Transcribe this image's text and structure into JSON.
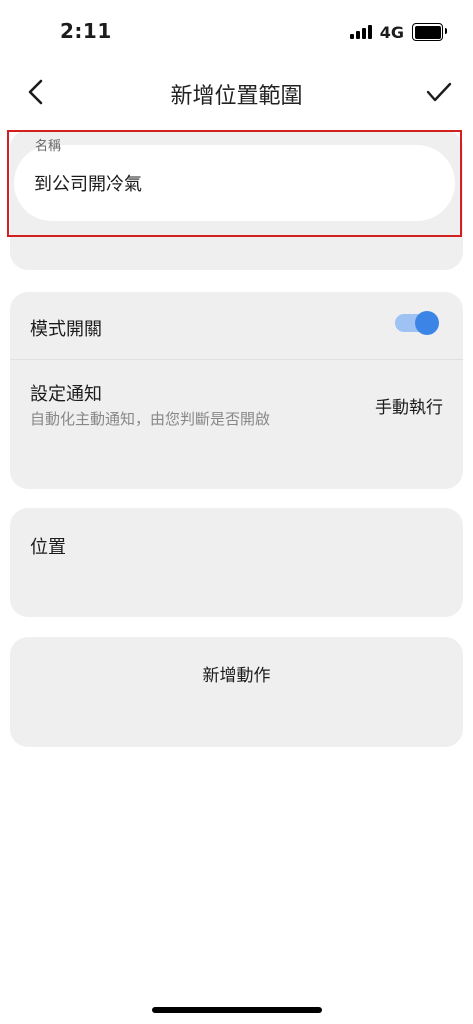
{
  "status_bar": {
    "time": "2:11",
    "network": "4G",
    "icons": {
      "signal": "cellular-signal-icon",
      "battery": "battery-icon"
    }
  },
  "nav": {
    "title": "新增位置範圍",
    "back_icon": "chevron-left-icon",
    "confirm_icon": "checkmark-icon"
  },
  "name_section": {
    "label": "名稱",
    "value": "到公司開冷氣",
    "highlight_color": "#d21f1f"
  },
  "settings": {
    "mode_label": "模式開關",
    "mode_enabled": true,
    "toggle_color": "#3c85e6",
    "notify_title": "設定通知",
    "notify_description": "自動化主動通知，由您判斷是否開啟",
    "notify_mode": "手動執行"
  },
  "location": {
    "label": "位置"
  },
  "actions": {
    "add_label": "新增動作"
  }
}
